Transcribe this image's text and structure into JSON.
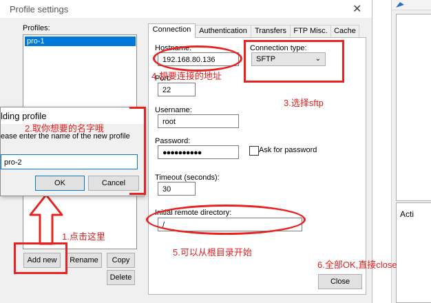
{
  "dialog": {
    "title": "Profile settings",
    "close_glyph": "✕",
    "profiles_label": "Profiles:",
    "profiles": [
      "pro-1"
    ],
    "buttons": {
      "add_new": "Add new",
      "rename": "Rename",
      "copy": "Copy",
      "delete": "Delete",
      "close": "Close"
    }
  },
  "tabs": [
    "Connection",
    "Authentication",
    "Transfers",
    "FTP Misc.",
    "Cache"
  ],
  "connection": {
    "hostname_label": "Hostname:",
    "hostname_value": "192.168.80.136",
    "connection_type_label": "Connection type:",
    "connection_type_value": "SFTP",
    "port_label": "Port:",
    "port_value": "22",
    "username_label": "Username:",
    "username_value": "root",
    "password_label": "Password:",
    "password_value": "●●●●●●●●●●",
    "ask_password_label": "Ask for password",
    "timeout_label": "Timeout (seconds):",
    "timeout_value": "30",
    "remote_dir_label": "Initial remote directory:",
    "remote_dir_value": "/"
  },
  "add_dialog": {
    "title": "lding profile",
    "prompt": "ease enter the name of the new profile",
    "value": "pro-2",
    "ok": "OK",
    "cancel": "Cancel"
  },
  "background_window": {
    "label": "Acti"
  },
  "annotations": {
    "a1": "1.点击这里",
    "a2": "2.取你想要的名字哦",
    "a3": "3.选择sftp",
    "a4": "4.想要连接的地址",
    "a5": "5.可以从根目录开始",
    "a6": "6.全部OK,直接close"
  },
  "colors": {
    "annotation": "#e62222",
    "selection": "#0078d7"
  }
}
